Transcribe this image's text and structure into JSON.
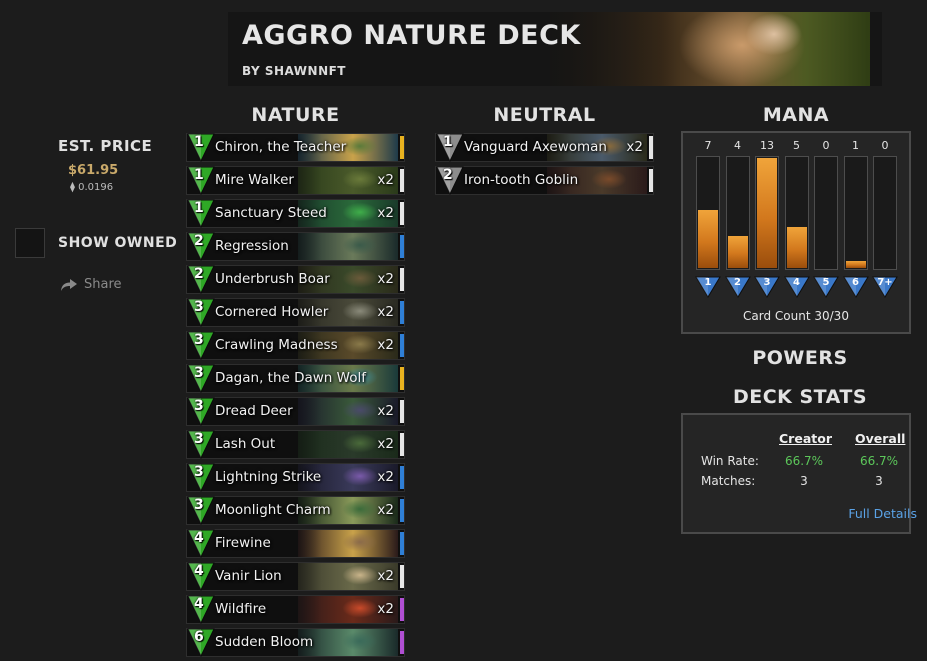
{
  "header": {
    "title": "AGGRO NATURE DECK",
    "author": "BY SHAWNNFT"
  },
  "left_panel": {
    "est_price_label": "EST. PRICE",
    "est_price_usd": "$61.95",
    "est_price_eth": "⧫ 0.0196",
    "show_owned_label": "SHOW OWNED",
    "show_owned_checked": false,
    "share_label": "Share"
  },
  "sections": {
    "nature": "NATURE",
    "neutral": "NEUTRAL",
    "mana": "MANA",
    "powers": "POWERS",
    "deck_stats": "DECK STATS"
  },
  "colors": {
    "nature_gem": "#2fa826",
    "neutral_gem": "#8d8d8d",
    "rarity_legendary": "#e8b21f",
    "rarity_rare": "#2f7fd6",
    "rarity_common": "#e6e6e6",
    "rarity_epic": "#b04fd3",
    "mana_fill": "#e08a25",
    "mana_gem": "#3a78c9",
    "stat_green": "#5cc75a",
    "link": "#5aa2e6"
  },
  "nature_cards": [
    {
      "cost": "1",
      "name": "Chiron, the Teacher",
      "qty": "",
      "rarity": "rarity_legendary",
      "art": [
        "#1e3a4a",
        "#5a7a3a",
        "#c9a24a"
      ]
    },
    {
      "cost": "1",
      "name": "Mire Walker",
      "qty": "x2",
      "rarity": "rarity_common",
      "art": [
        "#2a3a1a",
        "#6a7a3a",
        "#4a5a2a"
      ]
    },
    {
      "cost": "1",
      "name": "Sanctuary Steed",
      "qty": "x2",
      "rarity": "rarity_common",
      "art": [
        "#1a3a2a",
        "#3fae4a",
        "#2a6a3a"
      ]
    },
    {
      "cost": "2",
      "name": "Regression",
      "qty": "",
      "rarity": "rarity_rare",
      "art": [
        "#1a2a2a",
        "#3a5a4a",
        "#6a7a5a"
      ]
    },
    {
      "cost": "2",
      "name": "Underbrush Boar",
      "qty": "x2",
      "rarity": "rarity_common",
      "art": [
        "#2a2a1a",
        "#6a5a3a",
        "#3a4a2a"
      ]
    },
    {
      "cost": "3",
      "name": "Cornered Howler",
      "qty": "x2",
      "rarity": "rarity_rare",
      "art": [
        "#2a2a22",
        "#8a8a7a",
        "#4a4a3a"
      ]
    },
    {
      "cost": "3",
      "name": "Crawling Madness",
      "qty": "x2",
      "rarity": "rarity_rare",
      "art": [
        "#2a2a1a",
        "#8a7a4a",
        "#5a4a2a"
      ]
    },
    {
      "cost": "3",
      "name": "Dagan, the Dawn Wolf",
      "qty": "",
      "rarity": "rarity_legendary",
      "art": [
        "#1a3a3a",
        "#3a8a9a",
        "#6a7a4a"
      ]
    },
    {
      "cost": "3",
      "name": "Dread Deer",
      "qty": "x2",
      "rarity": "rarity_common",
      "art": [
        "#1a1a2a",
        "#4a4a6a",
        "#3a5a3a"
      ]
    },
    {
      "cost": "3",
      "name": "Lash Out",
      "qty": "x2",
      "rarity": "rarity_common",
      "art": [
        "#1a2a1a",
        "#4a6a3a",
        "#2a3a2a"
      ]
    },
    {
      "cost": "3",
      "name": "Lightning Strike",
      "qty": "x2",
      "rarity": "rarity_rare",
      "art": [
        "#1a1a2a",
        "#7a5aaa",
        "#3a3a5a"
      ]
    },
    {
      "cost": "3",
      "name": "Moonlight Charm",
      "qty": "x2",
      "rarity": "rarity_rare",
      "art": [
        "#1a2a1a",
        "#3a6a3a",
        "#8a9a5a"
      ]
    },
    {
      "cost": "4",
      "name": "Firewine",
      "qty": "",
      "rarity": "rarity_rare",
      "art": [
        "#2a1a1a",
        "#8a6a4a",
        "#c9a24a"
      ]
    },
    {
      "cost": "4",
      "name": "Vanir Lion",
      "qty": "x2",
      "rarity": "rarity_common",
      "art": [
        "#3a3a2a",
        "#c9b48a",
        "#6a6a4a"
      ]
    },
    {
      "cost": "4",
      "name": "Wildfire",
      "qty": "x2",
      "rarity": "rarity_epic",
      "art": [
        "#2a1a1a",
        "#c94a2a",
        "#6a2a1a"
      ]
    },
    {
      "cost": "6",
      "name": "Sudden Bloom",
      "qty": "",
      "rarity": "rarity_epic",
      "art": [
        "#1a2a2a",
        "#3a6a5a",
        "#5a8a6a"
      ]
    }
  ],
  "neutral_cards": [
    {
      "cost": "1",
      "name": "Vanguard Axewoman",
      "qty": "x2",
      "rarity": "rarity_common",
      "art": [
        "#2a2a1a",
        "#8a6a3a",
        "#4a5a6a"
      ]
    },
    {
      "cost": "2",
      "name": "Iron-tooth Goblin",
      "qty": "",
      "rarity": "rarity_common",
      "art": [
        "#2a1a1a",
        "#7a4a2a",
        "#4a3a2a"
      ]
    }
  ],
  "mana": {
    "max": 13,
    "bars": [
      {
        "label": "1",
        "count": 7
      },
      {
        "label": "2",
        "count": 4
      },
      {
        "label": "3",
        "count": 13
      },
      {
        "label": "4",
        "count": 5
      },
      {
        "label": "5",
        "count": 0
      },
      {
        "label": "6",
        "count": 1
      },
      {
        "label": "7+",
        "count": 0
      }
    ],
    "card_count": "Card Count 30/30"
  },
  "stats": {
    "creator_label": "Creator",
    "overall_label": "Overall",
    "win_rate_label": "Win Rate:",
    "matches_label": "Matches:",
    "creator_win_rate": "66.7%",
    "overall_win_rate": "66.7%",
    "creator_matches": "3",
    "overall_matches": "3",
    "full_details": "Full Details"
  }
}
